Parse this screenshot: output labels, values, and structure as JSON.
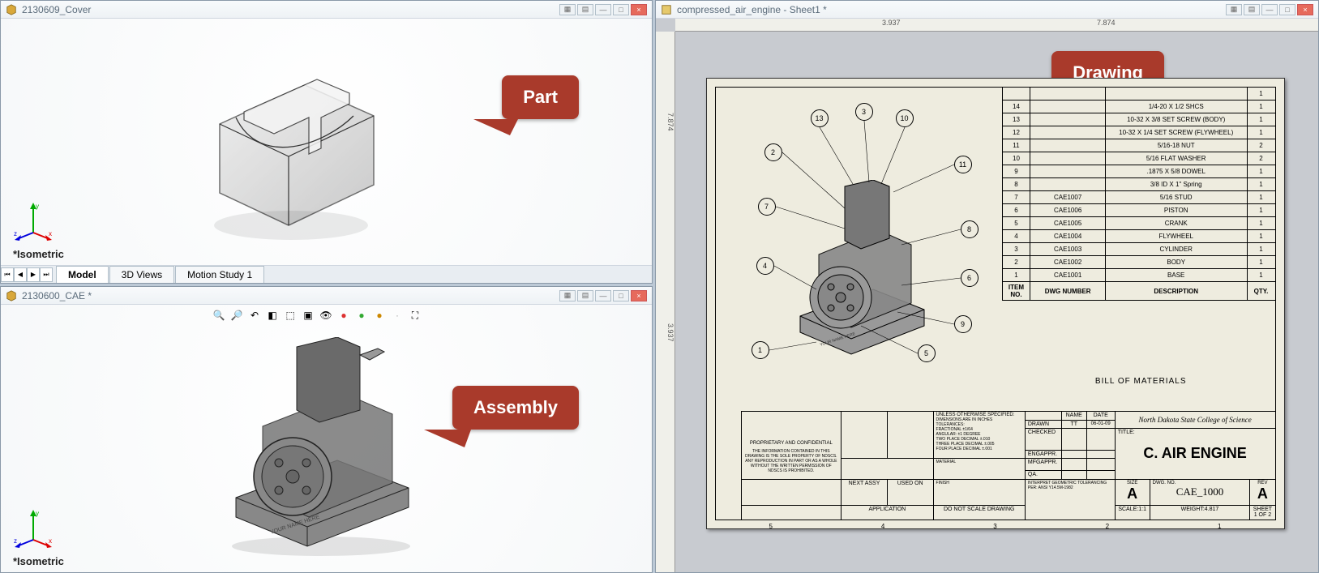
{
  "windows": {
    "part": {
      "title": "2130609_Cover",
      "view_label": "*Isometric",
      "tabs": [
        "Model",
        "3D Views",
        "Motion Study 1"
      ]
    },
    "assembly": {
      "title": "2130600_CAE *",
      "view_label": "*Isometric"
    },
    "drawing": {
      "title": "compressed_air_engine - Sheet1 *"
    }
  },
  "callouts": {
    "part": "Part",
    "assembly": "Assembly",
    "drawing": "Drawing"
  },
  "bom": {
    "header": {
      "item": "ITEM NO.",
      "dwg": "DWG NUMBER",
      "desc": "DESCRIPTION",
      "qty": "QTY."
    },
    "title": "BILL OF MATERIALS",
    "rows": [
      {
        "item": "",
        "dwg": "",
        "desc": "",
        "qty": "1"
      },
      {
        "item": "14",
        "dwg": "",
        "desc": "1/4-20 X 1/2 SHCS",
        "qty": "1"
      },
      {
        "item": "13",
        "dwg": "",
        "desc": "10-32 X 3/8 SET SCREW (BODY)",
        "qty": "1"
      },
      {
        "item": "12",
        "dwg": "",
        "desc": "10-32 X 1/4 SET SCREW (FLYWHEEL)",
        "qty": "1"
      },
      {
        "item": "11",
        "dwg": "",
        "desc": "5/16-18 NUT",
        "qty": "2"
      },
      {
        "item": "10",
        "dwg": "",
        "desc": "5/16 FLAT WASHER",
        "qty": "2"
      },
      {
        "item": "9",
        "dwg": "",
        "desc": ".1875 X 5/8 DOWEL",
        "qty": "1"
      },
      {
        "item": "8",
        "dwg": "",
        "desc": "3/8 ID X 1\" Spring",
        "qty": "1"
      },
      {
        "item": "7",
        "dwg": "CAE1007",
        "desc": "5/16 STUD",
        "qty": "1"
      },
      {
        "item": "6",
        "dwg": "CAE1006",
        "desc": "PISTON",
        "qty": "1"
      },
      {
        "item": "5",
        "dwg": "CAE1005",
        "desc": "CRANK",
        "qty": "1"
      },
      {
        "item": "4",
        "dwg": "CAE1004",
        "desc": "FLYWHEEL",
        "qty": "1"
      },
      {
        "item": "3",
        "dwg": "CAE1003",
        "desc": "CYLINDER",
        "qty": "1"
      },
      {
        "item": "2",
        "dwg": "CAE1002",
        "desc": "BODY",
        "qty": "1"
      },
      {
        "item": "1",
        "dwg": "CAE1001",
        "desc": "BASE",
        "qty": "1"
      }
    ]
  },
  "balloons": [
    "1",
    "2",
    "3",
    "4",
    "5",
    "6",
    "7",
    "8",
    "9",
    "10",
    "11",
    "13"
  ],
  "titleblock": {
    "school": "North Dakota State College of Science",
    "title_label": "TITLE:",
    "title": "C. AIR ENGINE",
    "size_label": "SIZE",
    "size": "A",
    "dwgno_label": "DWG. NO.",
    "dwgno": "CAE_1000",
    "rev_label": "REV",
    "rev": "A",
    "scale_label": "SCALE:1:1",
    "weight_label": "WEIGHT:4.817",
    "sheet_label": "SHEET 1 OF 2",
    "tolerances_header": "UNLESS OTHERWISE SPECIFIED:",
    "tol1": "DIMENSIONS ARE IN INCHES",
    "tol2": "TOLERANCES:",
    "tol3": "FRACTIONAL ±1/64",
    "tol4": "ANGULAR: ±1 DEGREE",
    "tol5": "TWO PLACE DECIMAL ±.010",
    "tol6": "THREE PLACE DECIMAL ±.005",
    "tol7": "FOUR PLACE DECIMAL ±.001",
    "col_name": "NAME",
    "col_date": "DATE",
    "drawn": "DRAWN",
    "drawn_name": "TT",
    "drawn_date": "06-01-09",
    "checked": "CHECKED",
    "engappr": "ENGAPPR.",
    "mfgappr": "MFGAPPR.",
    "qa": "QA.",
    "material": "MATERIAL",
    "finish": "FINISH",
    "geo_tol": "INTERPRET GEOMETRIC TOLERANCING PER: ANSI Y14.5M-1982",
    "prop_header": "PROPRIETARY AND CONFIDENTIAL",
    "prop_text": "THE INFORMATION CONTAINED IN THIS DRAWING IS THE SOLE PROPERTY OF NDSCS. ANY REPRODUCTION IN PART OR AS A WHOLE WITHOUT THE WRITTEN PERMISSION OF NDSCS IS PROHIBITED.",
    "nextassy": "NEXT ASSY",
    "usedon": "USED ON",
    "application": "APPLICATION",
    "dns": "DO NOT SCALE DRAWING"
  },
  "zone_marks": [
    "5",
    "4",
    "3",
    "2",
    "1"
  ],
  "rulers": {
    "h1": "3.937",
    "h2": "7.874",
    "v1": "7.874",
    "v2": "3.937"
  }
}
